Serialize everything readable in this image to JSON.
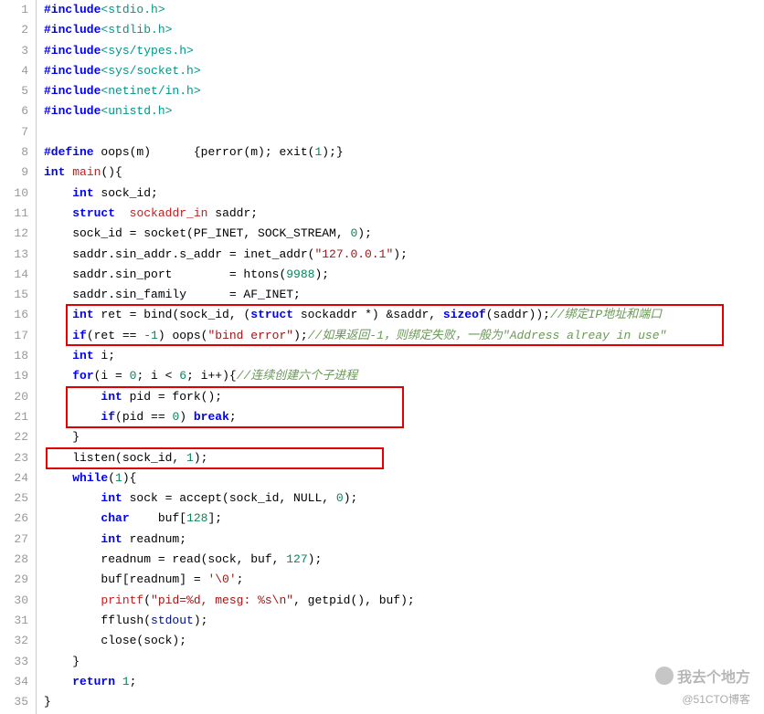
{
  "gutter": [
    "1",
    "2",
    "3",
    "4",
    "5",
    "6",
    "7",
    "8",
    "9",
    "10",
    "11",
    "12",
    "13",
    "14",
    "15",
    "16",
    "17",
    "18",
    "19",
    "20",
    "21",
    "22",
    "23",
    "24",
    "25",
    "26",
    "27",
    "28",
    "29",
    "30",
    "31",
    "32",
    "33",
    "34",
    "35"
  ],
  "lines": {
    "l1": {
      "include": "#include",
      "file": "<stdio.h>"
    },
    "l2": {
      "include": "#include",
      "file": "<stdlib.h>"
    },
    "l3": {
      "include": "#include",
      "file": "<sys/types.h>"
    },
    "l4": {
      "include": "#include",
      "file": "<sys/socket.h>"
    },
    "l5": {
      "include": "#include",
      "file": "<netinet/in.h>"
    },
    "l6": {
      "include": "#include",
      "file": "<unistd.h>"
    },
    "l8": {
      "define": "#define",
      "name": "oops(m)",
      "body1": "{perror(m); exit(",
      "num": "1",
      "body2": ");}"
    },
    "l9": {
      "kw1": "int",
      "main": "main",
      "paren": "(){"
    },
    "l10": {
      "kw": "int",
      "var": " sock_id;"
    },
    "l11": {
      "kw": "struct",
      "type": "sockaddr_in",
      "var": " saddr;"
    },
    "l12": {
      "pre": "    sock_id = socket(PF_INET, SOCK_STREAM, ",
      "num": "0",
      "post": ");"
    },
    "l13": {
      "pre": "    saddr.sin_addr.s_addr = inet_addr(",
      "str": "\"127.0.0.1\"",
      "post": ");"
    },
    "l14": {
      "pre": "    saddr.sin_port        = htons(",
      "num": "9988",
      "post": ");"
    },
    "l15": {
      "pre": "    saddr.sin_family      = AF_INET;"
    },
    "l16": {
      "kw": "int",
      "mid1": " ret = bind(sock_id, (",
      "kw2": "struct",
      "mid2": " sockaddr *) &saddr, ",
      "kw3": "sizeof",
      "mid3": "(saddr));",
      "comment": "//绑定IP地址和端口"
    },
    "l17": {
      "kw": "if",
      "pre": "(ret == ",
      "num": "-1",
      "mid": ") oops(",
      "str": "\"bind error\"",
      "post": ");",
      "comment": "//如果返回-1，则绑定失败，一般为\"Address alreay in use\""
    },
    "l18": {
      "kw": "int",
      "var": " i;"
    },
    "l19": {
      "kw": "for",
      "pre": "(i = ",
      "n1": "0",
      "mid1": "; i < ",
      "n2": "6",
      "mid2": "; i++){",
      "comment": "//连续创建六个子进程"
    },
    "l20": {
      "kw": "int",
      "var": " pid = fork();"
    },
    "l21": {
      "kw1": "if",
      "pre": "(pid == ",
      "num": "0",
      "mid": ") ",
      "kw2": "break",
      "post": ";"
    },
    "l22": {
      "text": "    }"
    },
    "l23": {
      "pre": "    listen(sock_id, ",
      "num": "1",
      "post": ");"
    },
    "l24": {
      "kw": "while",
      "pre": "(",
      "num": "1",
      "post": "){"
    },
    "l25": {
      "kw": "int",
      "mid": " sock = accept(sock_id, NULL, ",
      "num": "0",
      "post": ");"
    },
    "l26": {
      "kw": "char",
      "mid": "    buf[",
      "num": "128",
      "post": "];"
    },
    "l27": {
      "kw": "int",
      "var": " readnum;"
    },
    "l28": {
      "pre": "        readnum = read(sock, buf, ",
      "num": "127",
      "post": ");"
    },
    "l29": {
      "pre": "        buf[readnum] = ",
      "str": "'\\0'",
      "post": ";"
    },
    "l30": {
      "func": "printf",
      "pre": "(",
      "str": "\"pid=%d, mesg: %s\\n\"",
      "mid": ", getpid(), buf);"
    },
    "l31": {
      "pre": "        fflush(",
      "ident": "stdout",
      "post": ");"
    },
    "l32": {
      "pre": "        close(sock);"
    },
    "l33": {
      "text": "    }"
    },
    "l34": {
      "kw": "return",
      "num": " 1",
      "post": ";"
    },
    "l35": {
      "text": "}"
    }
  },
  "watermark1": "我去个地方",
  "watermark2": "@51CTO博客"
}
